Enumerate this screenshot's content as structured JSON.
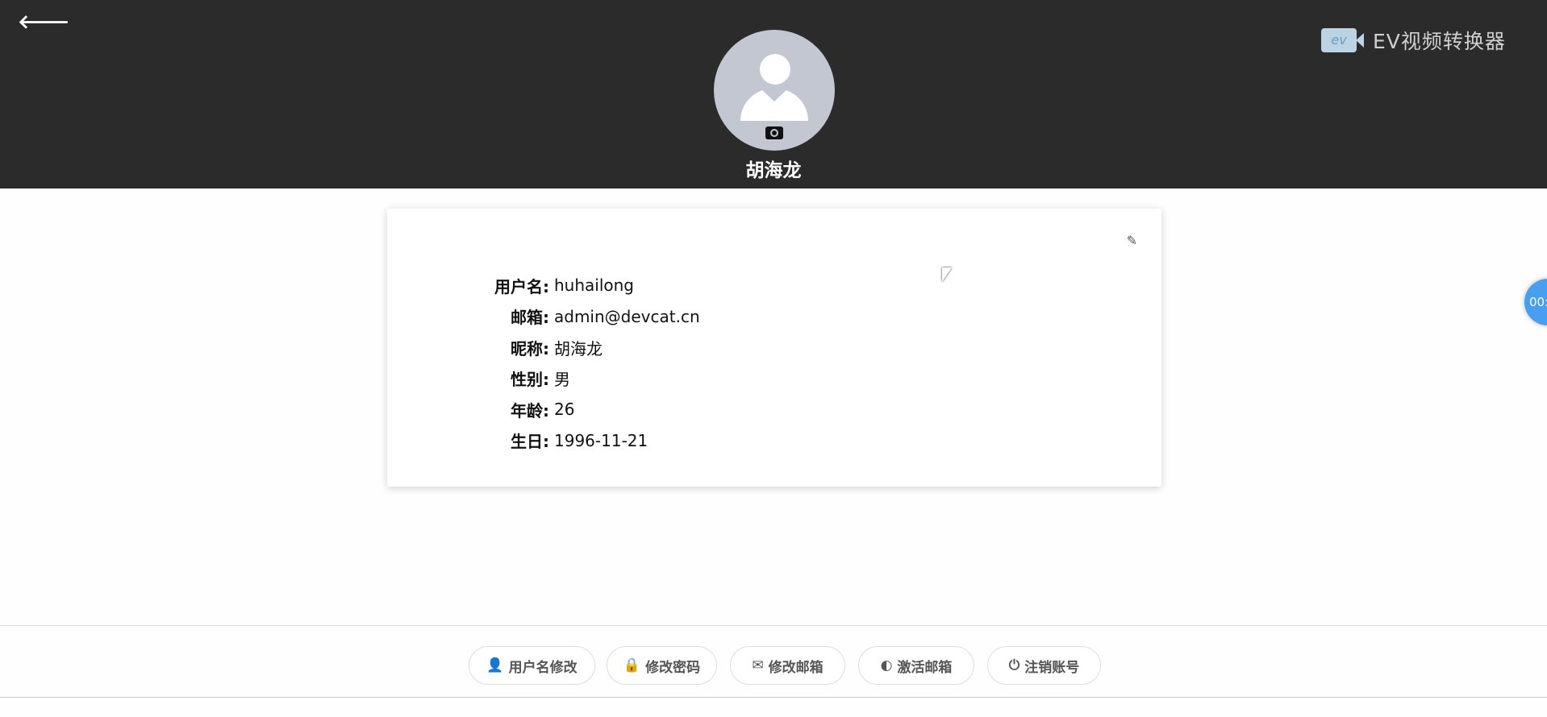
{
  "header": {
    "back_icon": "arrow-left",
    "logo_icon_text": "ev",
    "app_title": "EV视频转换器",
    "user_name": "胡海龙"
  },
  "profile": {
    "fields": [
      {
        "label": "用户名:",
        "value": "huhailong"
      },
      {
        "label": "邮箱:",
        "value": "admin@devcat.cn"
      },
      {
        "label": "昵称:",
        "value": "胡海龙"
      },
      {
        "label": "性别:",
        "value": "男"
      },
      {
        "label": "年龄:",
        "value": "26"
      },
      {
        "label": "生日:",
        "value": "1996-11-21"
      }
    ]
  },
  "actions": [
    {
      "icon": "user",
      "label": "用户名修改"
    },
    {
      "icon": "lock",
      "label": "修改密码"
    },
    {
      "icon": "envelope",
      "label": "修改邮箱"
    },
    {
      "icon": "toggle",
      "label": "激活邮箱"
    },
    {
      "icon": "power",
      "label": "注销账号"
    }
  ],
  "floating": {
    "text": "00:"
  }
}
